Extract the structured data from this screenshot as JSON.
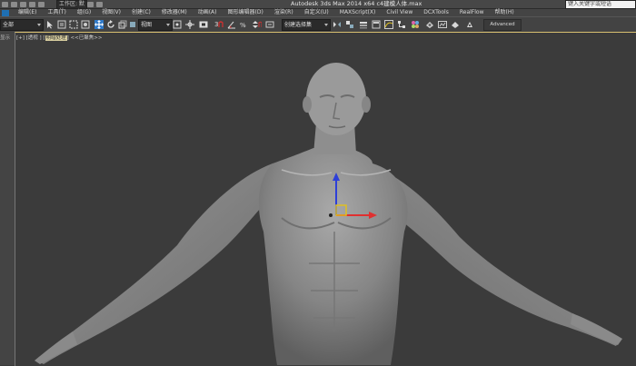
{
  "titlebar": {
    "workspace": "工作区: 默认",
    "app_title": "Autodesk 3ds Max  2014 x64     c4建模人体.max",
    "search_placeholder": "键入关键字或短语"
  },
  "menubar": {
    "items": [
      "编辑(E)",
      "工具(T)",
      "组(G)",
      "视图(V)",
      "创建(C)",
      "修改器(M)",
      "动画(A)",
      "图形编辑器(D)",
      "渲染(R)",
      "自定义(U)",
      "MAXScript(X)",
      "Civil View",
      "DCXTools",
      "RealFlow",
      "帮助(H)"
    ]
  },
  "toolbar": {
    "selection_filter": "全部",
    "reference_coord": "视图",
    "named_selection": "创建选择集",
    "advanced_paint": "Advanced Paint"
  },
  "viewport": {
    "left_label": "显示",
    "label_prefix": "[+] [透视 ] [",
    "label_highlight": "明暗处理",
    "label_suffix": "] <<已聚焦>>"
  },
  "colors": {
    "viewport_border": "#d8c070",
    "gizmo_x": "#e03030",
    "gizmo_y": "#e0c020",
    "gizmo_z": "#2d3fd8"
  }
}
